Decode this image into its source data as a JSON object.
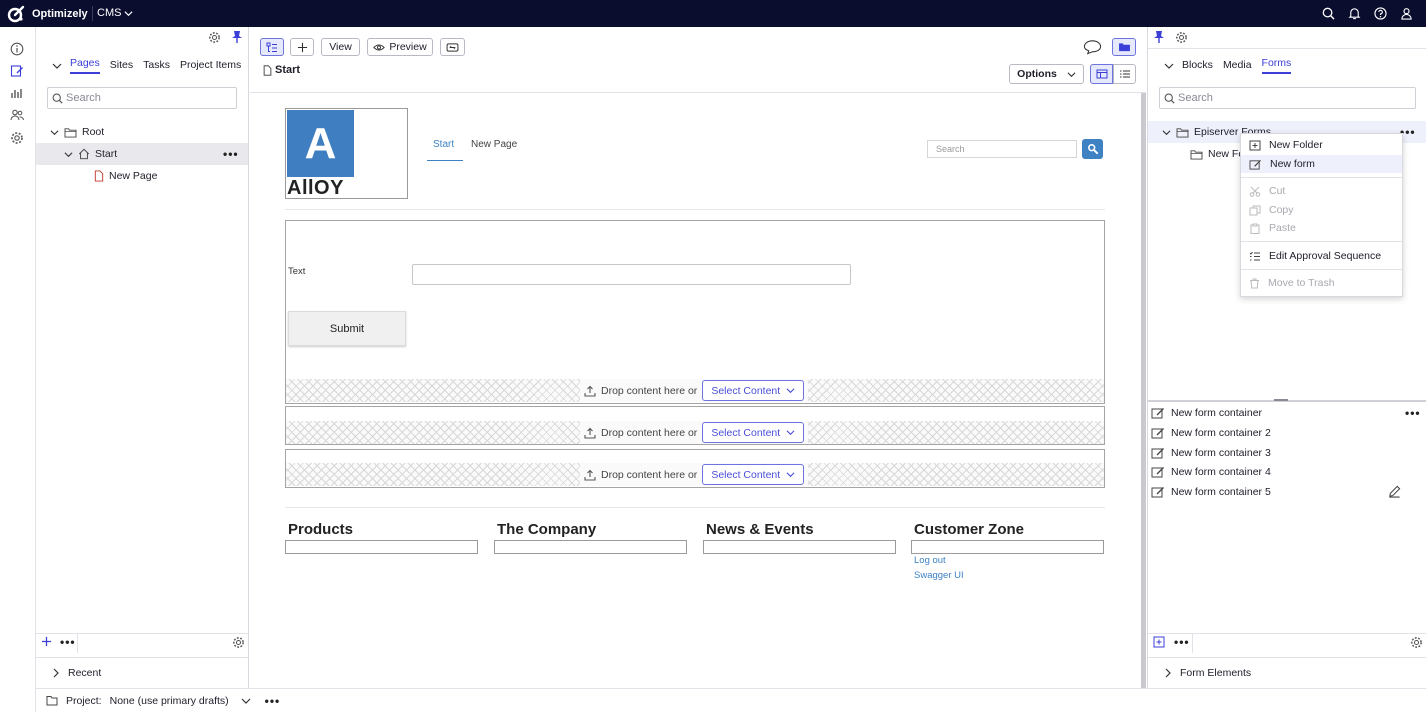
{
  "app": {
    "brand": "Optimizely",
    "product": "CMS"
  },
  "left_pane": {
    "tabs": [
      "Pages",
      "Sites",
      "Tasks",
      "Project Items"
    ],
    "active_tab": "Pages",
    "search_placeholder": "Search",
    "tree": [
      {
        "label": "Root",
        "icon": "folder-icon",
        "depth": 0
      },
      {
        "label": "Start",
        "icon": "home-icon",
        "depth": 1,
        "selected": true
      },
      {
        "label": "New Page",
        "icon": "page-icon",
        "depth": 2
      }
    ],
    "recent_label": "Recent"
  },
  "toolbar": {
    "view_label": "View",
    "preview_label": "Preview",
    "page_title": "Start",
    "options_label": "Options"
  },
  "preview": {
    "logo_letter": "A",
    "logo_text": "AllOY",
    "nav": [
      "Start",
      "New Page"
    ],
    "search_placeholder": "Search",
    "form_field_label": "Text",
    "submit_label": "Submit",
    "drop_text": "Drop content here or",
    "select_content_label": "Select Content",
    "footer_columns": [
      {
        "heading": "Products",
        "links": []
      },
      {
        "heading": "The Company",
        "links": []
      },
      {
        "heading": "News & Events",
        "links": []
      },
      {
        "heading": "Customer Zone",
        "links": [
          "Log out",
          "Swagger UI"
        ]
      }
    ]
  },
  "right_pane": {
    "tabs": [
      "Blocks",
      "Media",
      "Forms"
    ],
    "active_tab": "Forms",
    "search_placeholder": "Search",
    "root_folder": "Episerver Forms",
    "child_folder": "New Fo",
    "context_menu": [
      {
        "label": "New Folder",
        "icon": "new-folder-icon",
        "disabled": false
      },
      {
        "label": "New form",
        "icon": "new-form-icon",
        "disabled": false
      },
      {
        "label": "Cut",
        "icon": "cut-icon",
        "disabled": true
      },
      {
        "label": "Copy",
        "icon": "copy-icon",
        "disabled": true
      },
      {
        "label": "Paste",
        "icon": "paste-icon",
        "disabled": true
      },
      {
        "label": "Edit Approval Sequence",
        "icon": "approval-icon",
        "disabled": false
      },
      {
        "label": "Move to Trash",
        "icon": "trash-icon",
        "disabled": true
      }
    ],
    "form_containers": [
      "New form container",
      "New form container 2",
      "New form container 3",
      "New form container 4",
      "New form container 5"
    ],
    "form_elements_label": "Form Elements"
  },
  "bottom_bar": {
    "project_label": "Project:",
    "project_value": "None (use primary drafts)"
  },
  "colors": {
    "topbar": "#0b0d2f",
    "accent": "#3b3fd8",
    "link": "#3e82c4",
    "logo_blue": "#3f7ec1"
  }
}
